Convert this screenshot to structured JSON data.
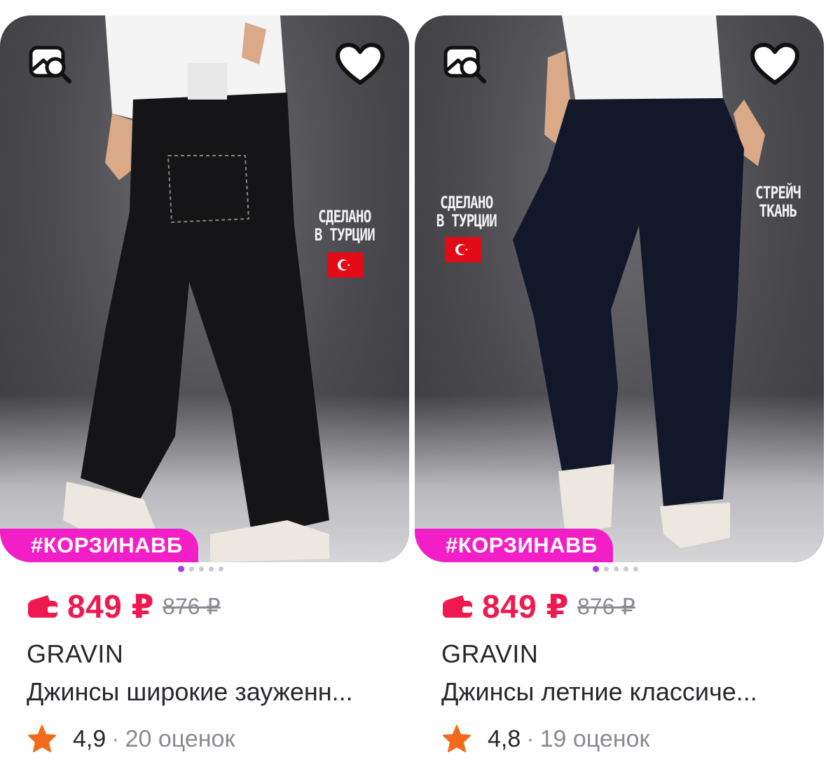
{
  "products": [
    {
      "overlay": "СДЕЛАНО\nВ ТУРЦИИ",
      "overlay2": "",
      "tag": "#КОРЗИНАВБ",
      "price": "849 ₽",
      "old_price": "876 ₽",
      "brand": "GRAVIN",
      "title": "Джинсы широкие зауженн...",
      "rating": "4,9",
      "reviews": "20 оценок",
      "dots": 5,
      "active_dot": 0
    },
    {
      "overlay": "СДЕЛАНО\nВ ТУРЦИИ",
      "overlay2": "СТРЕЙЧ\nТКАНЬ",
      "tag": "#КОРЗИНАВБ",
      "price": "849 ₽",
      "old_price": "876 ₽",
      "brand": "GRAVIN",
      "title": "Джинсы летние классиче...",
      "rating": "4,8",
      "reviews": "19 оценок",
      "dots": 5,
      "active_dot": 0
    }
  ],
  "icons": {
    "search": "image-search-icon",
    "favorite": "heart-icon",
    "wallet": "wallet-icon",
    "star": "star-icon",
    "flag": "turkey-flag-icon"
  },
  "colors": {
    "price": "#f0194f",
    "tag_bg": "#f21fc9",
    "star": "#f26b1d",
    "dot_active": "#a73ae0"
  },
  "separator": "·"
}
